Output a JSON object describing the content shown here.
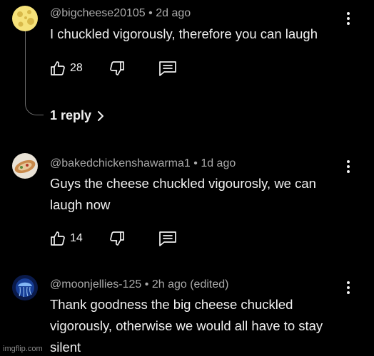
{
  "comments": [
    {
      "handle": "@bigcheese20105",
      "separator": "•",
      "time": "2d ago",
      "text": "I chuckled vigorously, therefore you can laugh",
      "likes": "28",
      "avatar_icon": "cheese-avatar-icon"
    },
    {
      "handle": "@bakedchickenshawarma1",
      "separator": "•",
      "time": "1d ago",
      "text": "Guys the cheese chuckled vigourosly, we can laugh now",
      "likes": "14",
      "avatar_icon": "shawarma-avatar-icon"
    },
    {
      "handle": "@moonjellies-125",
      "separator": "•",
      "time": "2h ago (edited)",
      "text": "Thank goodness the big cheese chuckled vigorously, otherwise we would all have to stay silent",
      "avatar_icon": "jellyfish-avatar-icon"
    }
  ],
  "replies_label": "1 reply",
  "watermark": "imgflip.com",
  "colors": {
    "background": "#000000",
    "text": "#f1f1f1",
    "meta": "#aaaaaa",
    "thread_line": "#6b6b6b"
  }
}
